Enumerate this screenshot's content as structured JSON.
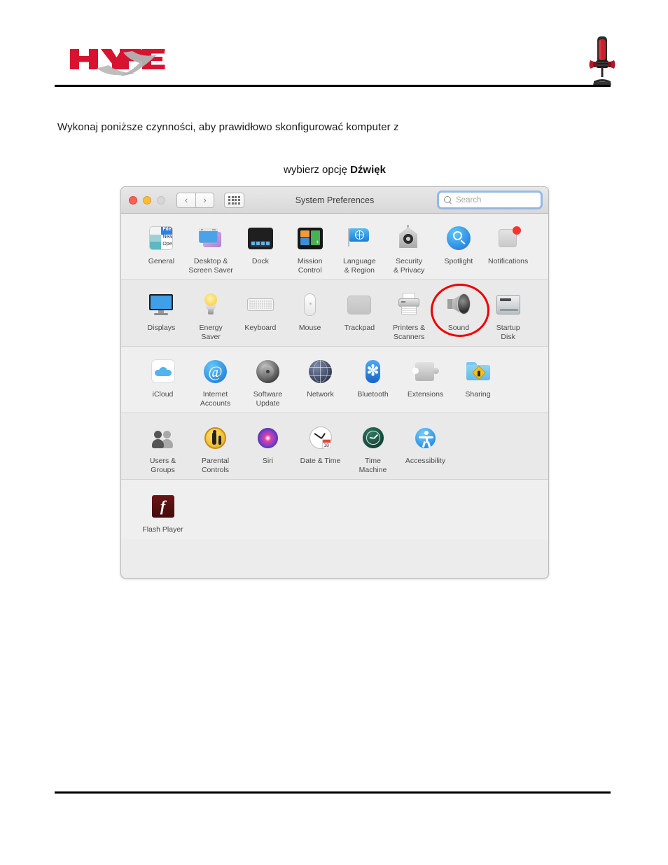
{
  "document": {
    "brand_logo_text": "HYPERX",
    "brand_tm": "™",
    "product_image": "hyperx-quadcast-microphone",
    "intro_paragraph": "Wykonaj poniższe czynności, aby prawidłowo skonfigurować komputer z",
    "caption_prefix": "wybierz opcję ",
    "caption_bold": "Dźwięk"
  },
  "colors": {
    "brand_red": "#d8132f",
    "brand_silver": "#b3b3b3",
    "annotation_red": "#ee0000",
    "focus_blue": "#5c96e8",
    "rule_black": "#000000"
  },
  "window": {
    "title": "System Preferences",
    "traffic_lights": [
      "close",
      "minimize",
      "zoom"
    ],
    "nav": {
      "back": "‹",
      "forward": "›"
    },
    "grid_button": "show-all-grid-icon",
    "search": {
      "placeholder": "Search",
      "value": "",
      "focused": true
    },
    "rows": [
      {
        "band": "band-a",
        "items": [
          {
            "id": "general",
            "label": "General",
            "icon": "general-icon"
          },
          {
            "id": "desktop",
            "label": "Desktop &\nScreen Saver",
            "icon": "desktop-screensaver-icon"
          },
          {
            "id": "dock",
            "label": "Dock",
            "icon": "dock-icon"
          },
          {
            "id": "mission-control",
            "label": "Mission\nControl",
            "icon": "mission-control-icon"
          },
          {
            "id": "language-region",
            "label": "Language\n& Region",
            "icon": "language-region-icon"
          },
          {
            "id": "security-privacy",
            "label": "Security\n& Privacy",
            "icon": "security-privacy-icon"
          },
          {
            "id": "spotlight",
            "label": "Spotlight",
            "icon": "spotlight-icon"
          },
          {
            "id": "notifications",
            "label": "Notifications",
            "icon": "notifications-icon"
          }
        ]
      },
      {
        "band": "band-b",
        "items": [
          {
            "id": "displays",
            "label": "Displays",
            "icon": "displays-icon"
          },
          {
            "id": "energy-saver",
            "label": "Energy\nSaver",
            "icon": "energy-saver-icon"
          },
          {
            "id": "keyboard",
            "label": "Keyboard",
            "icon": "keyboard-icon"
          },
          {
            "id": "mouse",
            "label": "Mouse",
            "icon": "mouse-icon"
          },
          {
            "id": "trackpad",
            "label": "Trackpad",
            "icon": "trackpad-icon"
          },
          {
            "id": "printers-scanners",
            "label": "Printers &\nScanners",
            "icon": "printers-scanners-icon"
          },
          {
            "id": "sound",
            "label": "Sound",
            "icon": "sound-icon",
            "highlighted": true
          },
          {
            "id": "startup-disk",
            "label": "Startup\nDisk",
            "icon": "startup-disk-icon"
          }
        ]
      },
      {
        "band": "band-a",
        "items": [
          {
            "id": "icloud",
            "label": "iCloud",
            "icon": "icloud-icon"
          },
          {
            "id": "internet-accounts",
            "label": "Internet\nAccounts",
            "icon": "internet-accounts-icon"
          },
          {
            "id": "software-update",
            "label": "Software\nUpdate",
            "icon": "software-update-icon"
          },
          {
            "id": "network",
            "label": "Network",
            "icon": "network-icon"
          },
          {
            "id": "bluetooth",
            "label": "Bluetooth",
            "icon": "bluetooth-icon"
          },
          {
            "id": "extensions",
            "label": "Extensions",
            "icon": "extensions-icon"
          },
          {
            "id": "sharing",
            "label": "Sharing",
            "icon": "sharing-icon"
          }
        ]
      },
      {
        "band": "band-b",
        "items": [
          {
            "id": "users-groups",
            "label": "Users &\nGroups",
            "icon": "users-groups-icon"
          },
          {
            "id": "parental-controls",
            "label": "Parental\nControls",
            "icon": "parental-controls-icon"
          },
          {
            "id": "siri",
            "label": "Siri",
            "icon": "siri-icon"
          },
          {
            "id": "date-time",
            "label": "Date & Time",
            "icon": "date-time-icon"
          },
          {
            "id": "time-machine",
            "label": "Time\nMachine",
            "icon": "time-machine-icon"
          },
          {
            "id": "accessibility",
            "label": "Accessibility",
            "icon": "accessibility-icon"
          }
        ]
      },
      {
        "band": "band-a",
        "items": [
          {
            "id": "flash-player",
            "label": "Flash Player",
            "icon": "flash-player-icon"
          }
        ]
      }
    ]
  },
  "icons": {
    "general_tiles": [
      "",
      "File",
      "",
      "New",
      "",
      "Ope"
    ],
    "date_badge": "18",
    "flash_glyph": "f",
    "bluetooth_glyph": "✼",
    "at_glyph": "@"
  }
}
